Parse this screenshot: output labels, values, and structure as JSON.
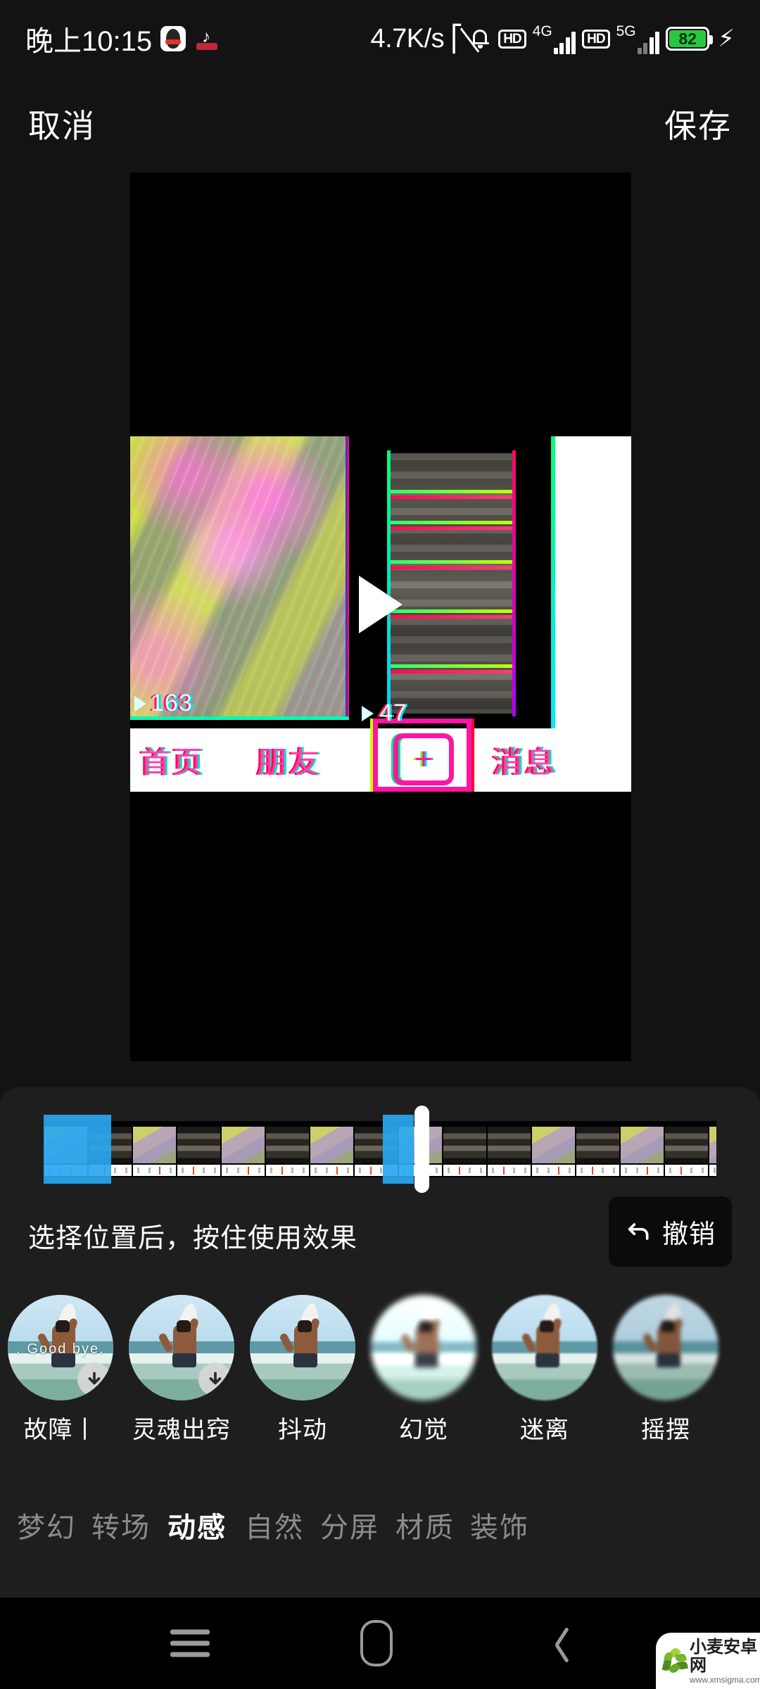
{
  "status_bar": {
    "time": "晚上10:15",
    "app_icons": [
      "qq-icon",
      "tiktok-icon"
    ],
    "network_speed": "4.7K/s",
    "bluetooth_icon": "bluetooth-icon",
    "mute_icon": "mute-bell-icon",
    "sim1": {
      "hd_label": "HD",
      "network_label": "4G"
    },
    "sim2": {
      "hd_label": "HD",
      "network_label": "5G"
    },
    "battery_percent": "82",
    "battery_color": "#27c840",
    "charging_icon": "charging-bolt-icon"
  },
  "top_nav": {
    "cancel_label": "取消",
    "save_label": "保存"
  },
  "preview": {
    "play_icon": "play-triangle-icon",
    "left_pane_views": "163",
    "right_pane_views": "47",
    "app_nav": {
      "home": "首页",
      "friends": "朋友",
      "create": "+",
      "messages": "消息"
    }
  },
  "timeline": {
    "playhead_label": "playhead",
    "selection_color": "#29a7ef"
  },
  "toolbar": {
    "hint": "选择位置后，按住使用效果",
    "undo_label": "撤销",
    "undo_icon": "undo-arrow-icon"
  },
  "effects": [
    {
      "name": "故障丨",
      "overlay_text": ". Good  bye.",
      "downloadable": true
    },
    {
      "name": "灵魂出窍",
      "overlay_text": "",
      "downloadable": true
    },
    {
      "name": "抖动",
      "overlay_text": "",
      "downloadable": false
    },
    {
      "name": "幻觉",
      "overlay_text": "",
      "downloadable": false
    },
    {
      "name": "迷离",
      "overlay_text": "",
      "downloadable": false
    },
    {
      "name": "摇摆",
      "overlay_text": "",
      "downloadable": false
    }
  ],
  "categories": [
    {
      "label": "梦幻",
      "active": false
    },
    {
      "label": "转场",
      "active": false
    },
    {
      "label": "动感",
      "active": true
    },
    {
      "label": "自然",
      "active": false
    },
    {
      "label": "分屏",
      "active": false
    },
    {
      "label": "材质",
      "active": false
    },
    {
      "label": "装饰",
      "active": false
    }
  ],
  "android_nav": {
    "recents_icon": "recents-menu-icon",
    "home_icon": "home-pill-icon",
    "back_icon": "back-chevron-icon"
  },
  "watermark": {
    "title": "小麦安卓网",
    "url": "www.xmsigma.com"
  }
}
